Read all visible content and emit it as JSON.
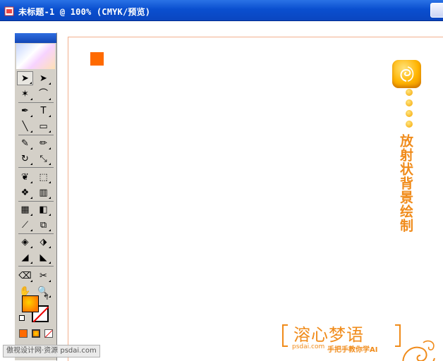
{
  "window": {
    "title": "未标题-1 @ 100% (CMYK/预览)"
  },
  "canvas": {
    "vertical_title": "放射状背景绘制",
    "brand": {
      "name": "溶心梦语",
      "domain": "psdai.com",
      "slogan": "手把手教你学AI"
    }
  },
  "toolbox": {
    "tools": [
      {
        "name": "selection-tool",
        "glyph": "➤"
      },
      {
        "name": "direct-selection-tool",
        "glyph": "➤"
      },
      {
        "name": "magic-wand-tool",
        "glyph": "✶"
      },
      {
        "name": "lasso-tool",
        "glyph": "⌒"
      },
      {
        "name": "pen-tool",
        "glyph": "✒"
      },
      {
        "name": "type-tool",
        "glyph": "T"
      },
      {
        "name": "line-segment-tool",
        "glyph": "╲"
      },
      {
        "name": "rectangle-tool",
        "glyph": "▭"
      },
      {
        "name": "paintbrush-tool",
        "glyph": "✎"
      },
      {
        "name": "pencil-tool",
        "glyph": "✏"
      },
      {
        "name": "rotate-tool",
        "glyph": "↻"
      },
      {
        "name": "scale-tool",
        "glyph": "⤡"
      },
      {
        "name": "warp-tool",
        "glyph": "❦"
      },
      {
        "name": "free-transform-tool",
        "glyph": "⬚"
      },
      {
        "name": "symbol-sprayer-tool",
        "glyph": "❖"
      },
      {
        "name": "column-graph-tool",
        "glyph": "▥"
      },
      {
        "name": "mesh-tool",
        "glyph": "▦"
      },
      {
        "name": "gradient-tool",
        "glyph": "◧"
      },
      {
        "name": "eyedropper-tool",
        "glyph": "⟋"
      },
      {
        "name": "blend-tool",
        "glyph": "⧉"
      },
      {
        "name": "live-paint-bucket-tool",
        "glyph": "◈"
      },
      {
        "name": "live-paint-selection-tool",
        "glyph": "⬗"
      },
      {
        "name": "slice-tool",
        "glyph": "◢"
      },
      {
        "name": "slice-select-tool",
        "glyph": "◣"
      },
      {
        "name": "eraser-tool",
        "glyph": "⌫"
      },
      {
        "name": "scissors-tool",
        "glyph": "✂"
      },
      {
        "name": "hand-tool",
        "glyph": "✋"
      },
      {
        "name": "zoom-tool",
        "glyph": "🔍"
      }
    ]
  },
  "watermark": {
    "text": "傲视设计网·资源 psdai.com"
  },
  "colors": {
    "accent": "#f08b1a",
    "square": "#ff6a00",
    "titlebar": "#0a4fcf"
  }
}
